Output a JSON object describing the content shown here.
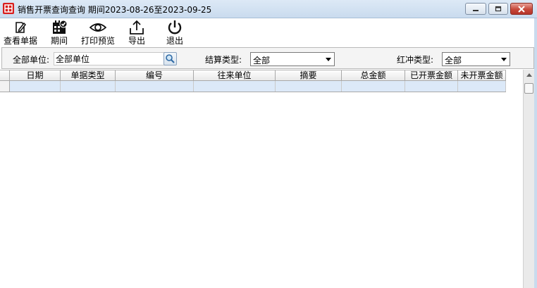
{
  "window": {
    "title": "销售开票查询查询 期间2023-08-26至2023-09-25",
    "app_icon": "grid-app-icon",
    "controls": [
      "minimize-icon",
      "maximize-icon",
      "close-icon"
    ],
    "accent": "#d81e1e"
  },
  "toolbar": {
    "items": [
      {
        "label": "查看单据",
        "icon": "edit-document-icon"
      },
      {
        "label": "期间",
        "icon": "calendar-check-icon"
      },
      {
        "label": "打印预览",
        "icon": "eye-icon"
      },
      {
        "label": "导出",
        "icon": "upload-icon"
      },
      {
        "label": "退出",
        "icon": "power-icon"
      }
    ]
  },
  "filters": {
    "unit_label": "全部单位:",
    "unit_value": "全部单位",
    "settlement_label": "结算类型:",
    "settlement_value": "全部",
    "red_flush_label": "红冲类型:",
    "red_flush_value": "全部"
  },
  "grid": {
    "columns": [
      "日期",
      "单据类型",
      "编号",
      "往来单位",
      "摘要",
      "总金额",
      "已开票金额",
      "未开票金额"
    ],
    "selected_row_color": "#dce9f8"
  }
}
